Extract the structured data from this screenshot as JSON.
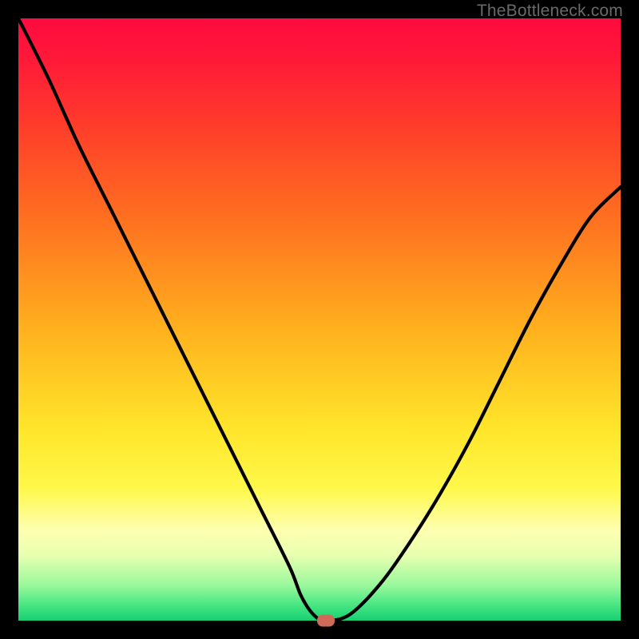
{
  "watermark": {
    "text": "TheBottleneck.com"
  },
  "chart_data": {
    "type": "line",
    "title": "",
    "xlabel": "",
    "ylabel": "",
    "xlim": [
      0,
      100
    ],
    "ylim": [
      0,
      100
    ],
    "grid": false,
    "legend": false,
    "background_gradient": {
      "from": "#ff0b3e",
      "through": [
        "#ffb21e",
        "#fff84a"
      ],
      "to": "#18cf72"
    },
    "series": [
      {
        "name": "bottleneck-curve",
        "color": "#000000",
        "x": [
          0,
          5,
          10,
          15,
          20,
          25,
          30,
          35,
          40,
          45,
          47,
          49,
          51,
          55,
          60,
          65,
          70,
          75,
          80,
          85,
          90,
          95,
          100
        ],
        "values": [
          100,
          90,
          79,
          69,
          59,
          49,
          39,
          29,
          19,
          9,
          4,
          1,
          0,
          1,
          6,
          13,
          21,
          30,
          40,
          50,
          59,
          67,
          72
        ]
      }
    ],
    "minimum_point": {
      "x": 51,
      "y": 0,
      "color": "#cf6a58"
    }
  }
}
